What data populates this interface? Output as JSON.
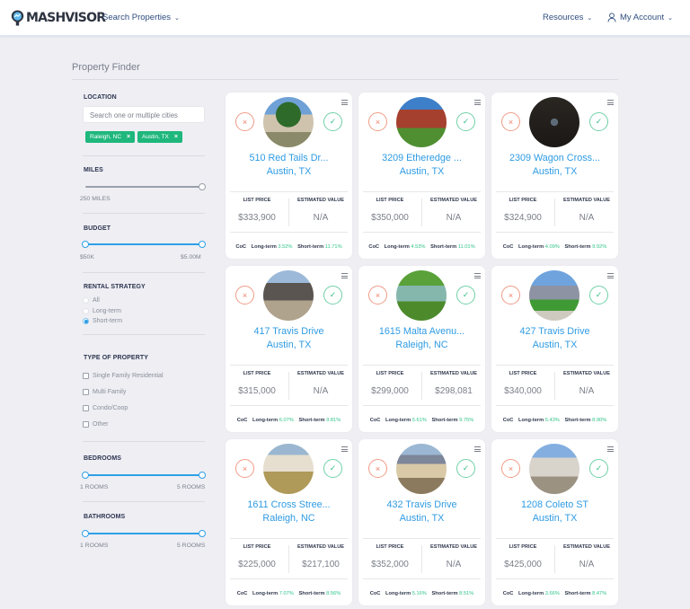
{
  "header": {
    "brand": "MASHVISOR",
    "nav": {
      "search_properties": "Search Properties",
      "resources": "Resources",
      "my_account": "My Account"
    },
    "icons": {
      "chevron": "chevron-down-icon",
      "user": "user-icon",
      "logo": "map-pin-logo-icon"
    }
  },
  "page": {
    "title": "Property Finder"
  },
  "sidebar": {
    "location": {
      "label": "LOCATION",
      "placeholder": "Search one or multiple cities",
      "value": "",
      "chips": [
        {
          "label": "Raleigh, NC",
          "remove": "×"
        },
        {
          "label": "Austin, TX",
          "remove": "×"
        }
      ]
    },
    "miles": {
      "label": "MILES",
      "value_label": "250 MILES",
      "value": 250
    },
    "budget": {
      "label": "BUDGET",
      "min_label": "$50K",
      "max_label": "$5.00M",
      "min": 50000,
      "max": 5000000
    },
    "rental_strategy": {
      "label": "RENTAL STRATEGY",
      "options": [
        "All",
        "Long-term",
        "Short-term"
      ],
      "selected": "Short-term"
    },
    "property_type": {
      "label": "TYPE OF PROPERTY",
      "options": [
        {
          "label": "Single Family Residential",
          "checked": false
        },
        {
          "label": "Multi Family",
          "checked": false
        },
        {
          "label": "Condo/Coop",
          "checked": false
        },
        {
          "label": "Other",
          "checked": false
        }
      ]
    },
    "bedrooms": {
      "label": "BEDROOMS",
      "min_label": "1 ROOMS",
      "max_label": "5 ROOMS",
      "min": 1,
      "max": 5
    },
    "bathrooms": {
      "label": "BATHROOMS",
      "min_label": "1 ROOMS",
      "max_label": "5 ROOMS",
      "min": 1,
      "max": 5
    }
  },
  "card_labels": {
    "list_price": "LIST PRICE",
    "estimated_value": "ESTIMATED VALUE",
    "coc": "CoC",
    "long_term": "Long-term",
    "short_term": "Short-term",
    "reject_glyph": "×",
    "accept_glyph": "✓"
  },
  "colors": {
    "accent_blue": "#2e9be3",
    "chip_green": "#1fb77c",
    "pct_green": "#2fc48a",
    "reject_red": "#ef7b62",
    "accept_green": "#3bbf88"
  },
  "properties": [
    {
      "address": "510 Red Tails Dr...",
      "city": "Austin, TX",
      "list_price": "$333,900",
      "estimated_value": "N/A",
      "coc_long": "3.52%",
      "coc_short": "11.71%",
      "photo": "house-photo-tree"
    },
    {
      "address": "3209 Etheredge ...",
      "city": "Austin, TX",
      "list_price": "$350,000",
      "estimated_value": "N/A",
      "coc_long": "4.53%",
      "coc_short": "11.01%",
      "photo": "house-photo-brick"
    },
    {
      "address": "2309 Wagon Cross...",
      "city": "Austin, TX",
      "list_price": "$324,900",
      "estimated_value": "N/A",
      "coc_long": "4.09%",
      "coc_short": "9.92%",
      "photo": "placeholder-photo-dark"
    },
    {
      "address": "417 Travis Drive",
      "city": "Austin, TX",
      "list_price": "$315,000",
      "estimated_value": "N/A",
      "coc_long": "6.07%",
      "coc_short": "9.81%",
      "photo": "house-photo-construction"
    },
    {
      "address": "1615 Malta Avenu...",
      "city": "Raleigh, NC",
      "list_price": "$299,000",
      "estimated_value": "$298,081",
      "coc_long": "5.61%",
      "coc_short": "9.75%",
      "photo": "house-photo-green"
    },
    {
      "address": "427 Travis Drive",
      "city": "Austin, TX",
      "list_price": "$340,000",
      "estimated_value": "N/A",
      "coc_long": "5.43%",
      "coc_short": "8.90%",
      "photo": "house-photo-driveway"
    },
    {
      "address": "1611 Cross Stree...",
      "city": "Raleigh, NC",
      "list_price": "$225,000",
      "estimated_value": "$217,100",
      "coc_long": "7.07%",
      "coc_short": "8.56%",
      "photo": "house-photo-cottage"
    },
    {
      "address": "432 Travis Drive",
      "city": "Austin, TX",
      "list_price": "$352,000",
      "estimated_value": "N/A",
      "coc_long": "5.16%",
      "coc_short": "8.51%",
      "photo": "house-photo-twostory"
    },
    {
      "address": "1208 Coleto ST",
      "city": "Austin, TX",
      "list_price": "$425,000",
      "estimated_value": "N/A",
      "coc_long": "3.66%",
      "coc_short": "8.47%",
      "photo": "house-photo-white"
    }
  ]
}
